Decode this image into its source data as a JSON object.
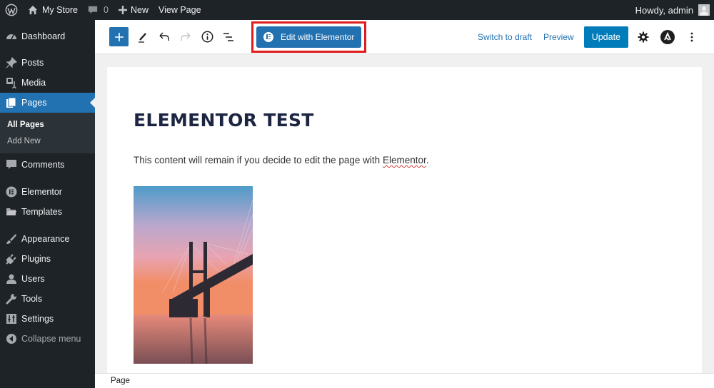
{
  "admin_bar": {
    "logo_icon": "wordpress-logo-icon",
    "site_name": "My Store",
    "comments_count": "0",
    "new_label": "New",
    "view_page_label": "View Page",
    "greeting": "Howdy, admin"
  },
  "sidebar": {
    "items": [
      {
        "label": "Dashboard",
        "icon": "dashboard-icon"
      },
      {
        "label": "Posts",
        "icon": "pin-icon"
      },
      {
        "label": "Media",
        "icon": "media-icon"
      },
      {
        "label": "Pages",
        "icon": "pages-icon",
        "active": true
      },
      {
        "label": "Comments",
        "icon": "comment-icon"
      },
      {
        "label": "Elementor",
        "icon": "elementor-icon"
      },
      {
        "label": "Templates",
        "icon": "folder-icon"
      },
      {
        "label": "Appearance",
        "icon": "brush-icon"
      },
      {
        "label": "Plugins",
        "icon": "plug-icon"
      },
      {
        "label": "Users",
        "icon": "user-icon"
      },
      {
        "label": "Tools",
        "icon": "wrench-icon"
      },
      {
        "label": "Settings",
        "icon": "sliders-icon"
      }
    ],
    "submenu": [
      {
        "label": "All Pages",
        "current": true
      },
      {
        "label": "Add New"
      }
    ],
    "collapse_label": "Collapse menu"
  },
  "toolbar": {
    "edit_with_elementor": "Edit with Elementor",
    "switch_to_draft": "Switch to draft",
    "preview": "Preview",
    "update": "Update"
  },
  "content": {
    "title": "ELEMENTOR TEST",
    "paragraph_before": "This content will remain if you decide to edit the page with ",
    "paragraph_link": "Elementor",
    "paragraph_after": ".",
    "image_alt": "Bridge at sunset"
  },
  "footer": {
    "breadcrumb": "Page"
  },
  "colors": {
    "accent": "#2271b1",
    "highlight_border": "#e11c1c",
    "admin_dark": "#1d2327",
    "title_color": "#1c2541"
  }
}
